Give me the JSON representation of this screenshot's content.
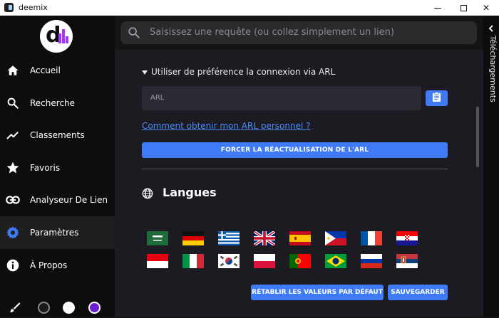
{
  "window": {
    "title": "deemix",
    "minimize": "—",
    "maximize": "☐",
    "close": "✕"
  },
  "sidebar": {
    "logo_letter": "d",
    "items": [
      {
        "label": "Accueil",
        "icon": "home-icon"
      },
      {
        "label": "Recherche",
        "icon": "search-icon"
      },
      {
        "label": "Classements",
        "icon": "trending-icon"
      },
      {
        "label": "Favoris",
        "icon": "star-icon"
      },
      {
        "label": "Analyseur De Lien",
        "icon": "link-icon"
      },
      {
        "label": "Paramètres",
        "icon": "gear-icon",
        "active": true
      },
      {
        "label": "À Propos",
        "icon": "info-icon"
      }
    ],
    "theme_icon": "brush-icon",
    "themes": [
      {
        "name": "dark",
        "color": "#1a1a1a"
      },
      {
        "name": "light",
        "color": "#ffffff"
      },
      {
        "name": "purple",
        "color": "#6c1fd1"
      }
    ]
  },
  "search": {
    "placeholder": "Saisissez une requête (ou collez simplement un lien)"
  },
  "settings": {
    "arl_toggle_label": "Utiliser de préférence la connexion via ARL",
    "arl_placeholder": "ARL",
    "arl_help_link": "Comment obtenir mon ARL personnel ?",
    "force_refresh_button": "FORCER LA RÉACTUALISATION DE L'ARL",
    "languages_title": "Langues",
    "languages": [
      {
        "code": "ar",
        "name": "arabic-flag"
      },
      {
        "code": "de",
        "name": "germany-flag"
      },
      {
        "code": "el",
        "name": "greece-flag"
      },
      {
        "code": "en",
        "name": "uk-flag"
      },
      {
        "code": "es",
        "name": "spain-flag"
      },
      {
        "code": "fil",
        "name": "philippines-flag"
      },
      {
        "code": "fr",
        "name": "france-flag"
      },
      {
        "code": "hr",
        "name": "croatia-flag"
      },
      {
        "code": "id",
        "name": "indonesia-flag"
      },
      {
        "code": "it",
        "name": "italy-flag"
      },
      {
        "code": "ko",
        "name": "korea-flag"
      },
      {
        "code": "pl",
        "name": "poland-flag"
      },
      {
        "code": "pt",
        "name": "portugal-flag"
      },
      {
        "code": "pt-br",
        "name": "brazil-flag"
      },
      {
        "code": "ru",
        "name": "russia-flag"
      },
      {
        "code": "sr",
        "name": "serbia-flag"
      }
    ],
    "reset_button": "RÉTABLIR LES VALEURS PAR DÉFAUT",
    "save_button": "SAUVEGARDER"
  },
  "right_panel": {
    "label": "Téléchargements"
  },
  "colors": {
    "accent": "#3f7bf7",
    "link": "#4a8cf7",
    "logo_purple": "#a238ff"
  }
}
